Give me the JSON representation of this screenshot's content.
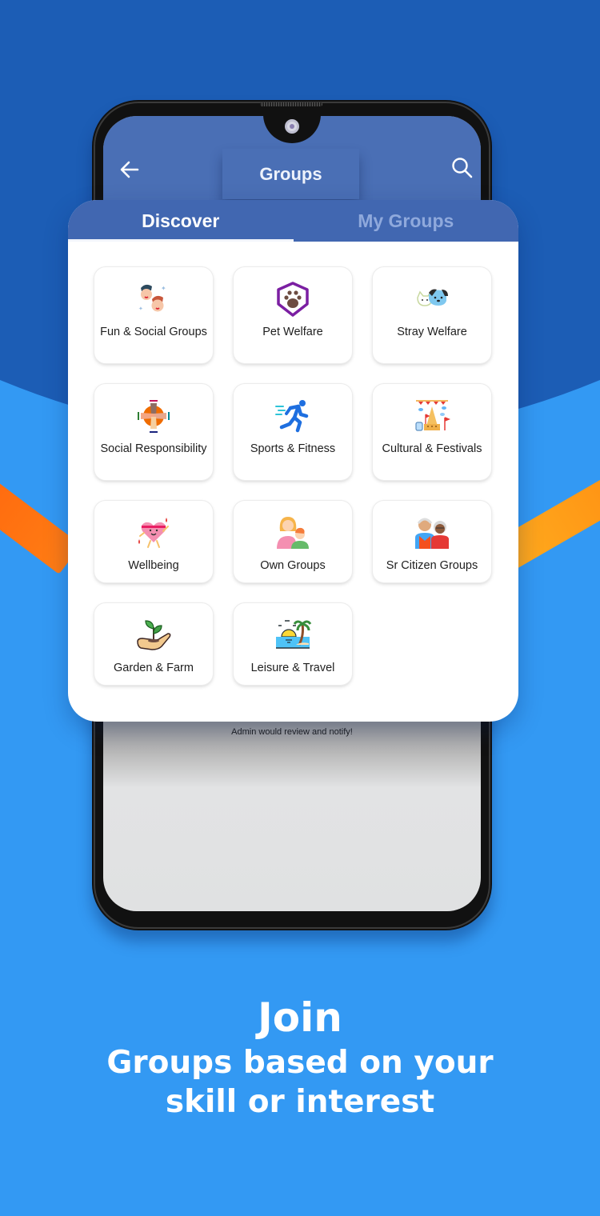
{
  "colors": {
    "background_top": "#1c5db5",
    "background_bottom": "#3399f3",
    "accent_orange": "#ff7a12",
    "appbar": "#4a6fb5",
    "tabbar": "#4167b1",
    "tab_inactive_text": "#8fa9dc"
  },
  "appbar": {
    "title": "Groups",
    "back_icon": "arrow-left-icon",
    "search_icon": "search-icon"
  },
  "tabs": [
    {
      "label": "Discover",
      "active": true
    },
    {
      "label": "My Groups",
      "active": false
    }
  ],
  "groups": [
    {
      "label": "Fun & Social Groups",
      "icon": "two-faces-icon"
    },
    {
      "label": "Pet Welfare",
      "icon": "paw-shield-icon"
    },
    {
      "label": "Stray Welfare",
      "icon": "cat-dog-icon"
    },
    {
      "label": "Social Responsibility",
      "icon": "joined-hands-icon"
    },
    {
      "label": "Sports & Fitness",
      "icon": "runner-icon"
    },
    {
      "label": "Cultural & Festivals",
      "icon": "festival-temple-icon"
    },
    {
      "label": "Wellbeing",
      "icon": "happy-heart-icon"
    },
    {
      "label": "Own Groups",
      "icon": "mother-child-icon"
    },
    {
      "label": "Sr Citizen Groups",
      "icon": "elderly-couple-icon"
    },
    {
      "label": "Garden & Farm",
      "icon": "sprout-hand-icon"
    },
    {
      "label": "Leisure & Travel",
      "icon": "beach-sunset-icon"
    }
  ],
  "screen_message": "Admin would review and notify!",
  "caption": {
    "headline": "Join",
    "subline_1": "Groups based on your",
    "subline_2": "skill or interest"
  }
}
